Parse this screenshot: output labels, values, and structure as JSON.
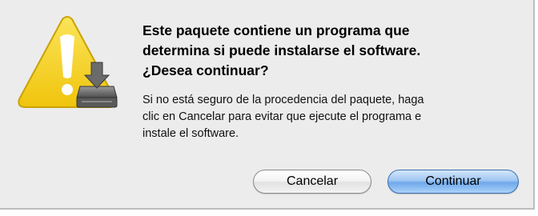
{
  "dialog": {
    "title_line_1": "Este paquete contiene un programa que",
    "title_line_2": "determina si puede instalarse el software.",
    "title_line_3": "¿Desea continuar?",
    "body_line_1": "Si no está seguro de la procedencia del paquete, haga",
    "body_line_2": "clic en Cancelar para evitar que ejecute el programa e",
    "body_line_3": "instale el software.",
    "icon": "warning-with-installer-disk-icon",
    "cancel_label": "Cancelar",
    "continue_label": "Continuar"
  },
  "colors": {
    "background": "#ececec",
    "warning_yellow": "#f6d21d",
    "default_button_blue": "#6fa8ea"
  }
}
